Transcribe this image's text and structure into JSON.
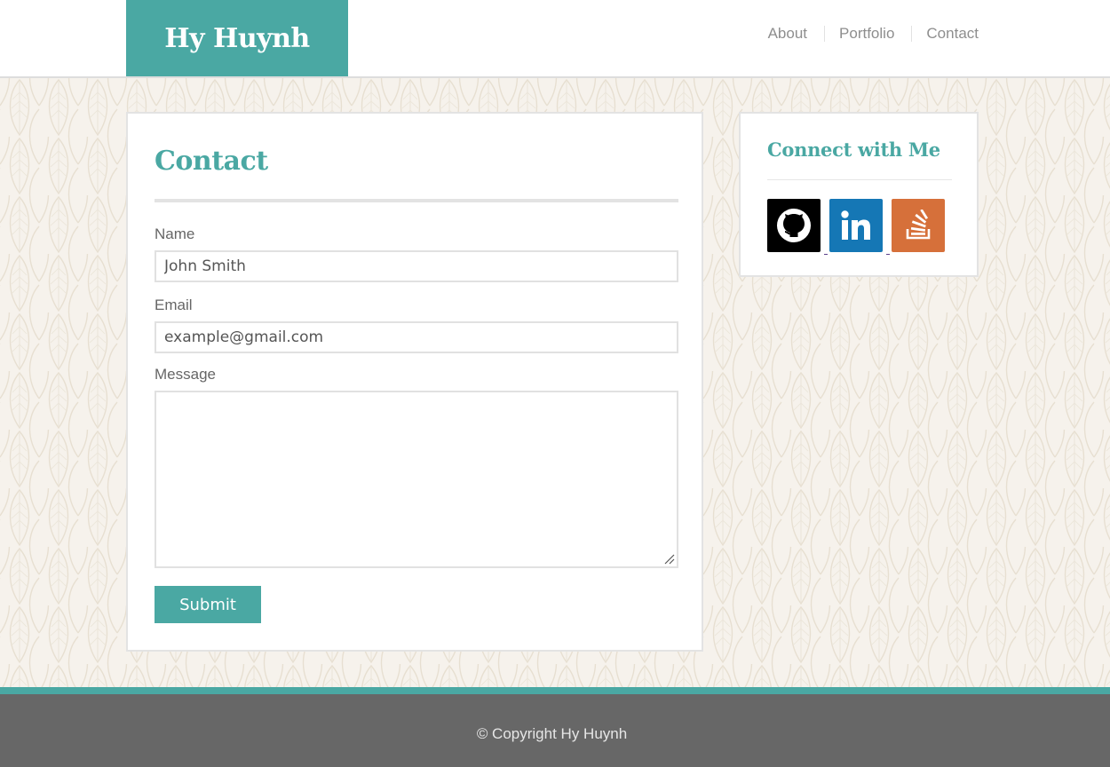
{
  "header": {
    "logo": "Hy Huynh",
    "nav": [
      "About",
      "Portfolio",
      "Contact"
    ]
  },
  "contact": {
    "title": "Contact",
    "name_label": "Name",
    "name_value": "John Smith",
    "email_label": "Email",
    "email_value": "example@gmail.com",
    "message_label": "Message",
    "message_value": "",
    "submit_label": "Submit"
  },
  "sidebar": {
    "title": "Connect with Me",
    "links": [
      {
        "name": "github-icon",
        "color": "#000000"
      },
      {
        "name": "linkedin-icon",
        "color": "#1577b5"
      },
      {
        "name": "stackoverflow-icon",
        "color": "#d6703a"
      }
    ]
  },
  "footer": {
    "copyright": "© Copyright Hy Huynh"
  },
  "colors": {
    "accent": "#4aa8a3",
    "footer_bg": "#676767"
  }
}
